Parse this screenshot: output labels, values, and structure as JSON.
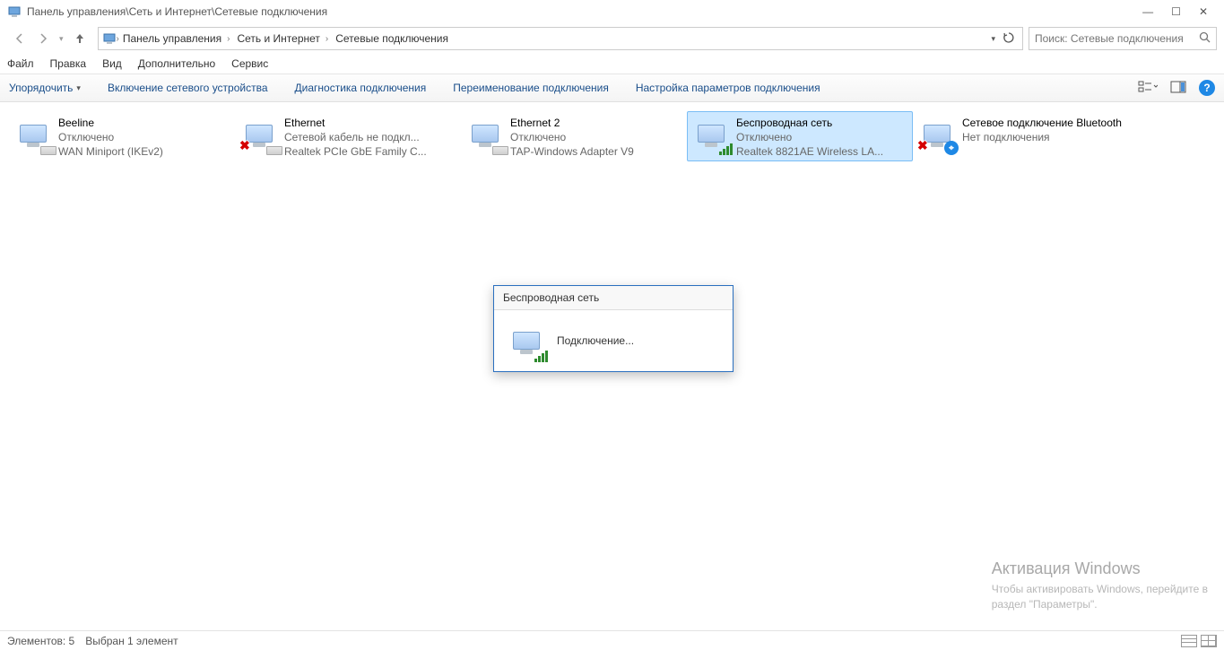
{
  "window": {
    "title": "Панель управления\\Сеть и Интернет\\Сетевые подключения"
  },
  "breadcrumbs": {
    "root_glyph": "›",
    "items": [
      "Панель управления",
      "Сеть и Интернет",
      "Сетевые подключения"
    ]
  },
  "search": {
    "placeholder": "Поиск: Сетевые подключения"
  },
  "menubar": {
    "file": "Файл",
    "edit": "Правка",
    "view": "Вид",
    "extra": "Дополнительно",
    "service": "Сервис"
  },
  "toolbar": {
    "organize": "Упорядочить",
    "enable": "Включение сетевого устройства",
    "diagnose": "Диагностика подключения",
    "rename": "Переименование подключения",
    "settings": "Настройка параметров подключения"
  },
  "connections": [
    {
      "name": "Beeline",
      "status": "Отключено",
      "device": "WAN Miniport (IKEv2)",
      "icon": "vpn",
      "error": false,
      "selected": false
    },
    {
      "name": "Ethernet",
      "status": "Сетевой кабель не подкл...",
      "device": "Realtek PCIe GbE Family C...",
      "icon": "ethernet",
      "error": true,
      "selected": false
    },
    {
      "name": "Ethernet 2",
      "status": "Отключено",
      "device": "TAP-Windows Adapter V9",
      "icon": "ethernet",
      "error": false,
      "selected": false
    },
    {
      "name": "Беспроводная сеть",
      "status": "Отключено",
      "device": "Realtek 8821AE Wireless LA...",
      "icon": "wifi",
      "error": false,
      "selected": true
    },
    {
      "name": "Сетевое подключение Bluetooth",
      "status": "Нет подключения",
      "device": "",
      "icon": "bluetooth",
      "error": true,
      "selected": false
    }
  ],
  "dialog": {
    "title": "Беспроводная сеть",
    "body": "Подключение..."
  },
  "watermark": {
    "title": "Активация Windows",
    "line1": "Чтобы активировать Windows, перейдите в",
    "line2": "раздел \"Параметры\"."
  },
  "statusbar": {
    "count_label": "Элементов:",
    "count_value": "5",
    "selected": "Выбран 1 элемент"
  }
}
